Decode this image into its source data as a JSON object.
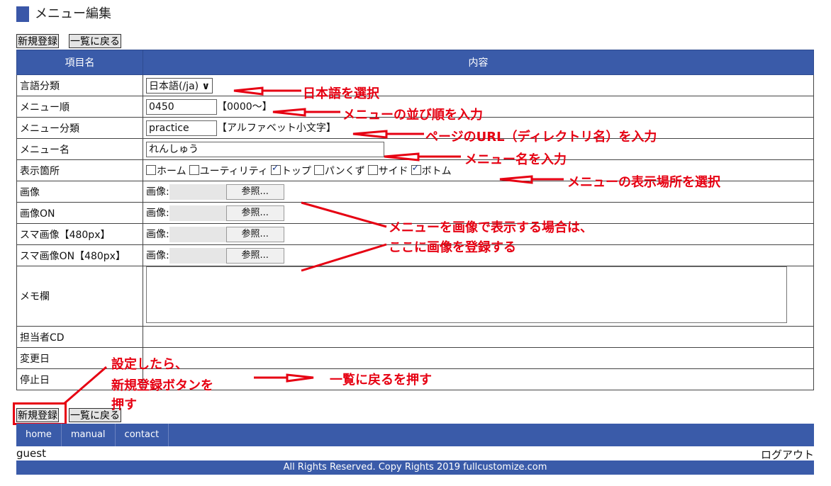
{
  "page": {
    "title": "メニュー編集"
  },
  "top_buttons": {
    "new": "新規登録",
    "list": "一覧に戻る"
  },
  "table": {
    "headers": [
      "項目名",
      "内容"
    ],
    "rows": {
      "language": {
        "label": "言語分類",
        "value": "日本語(/ja)",
        "arrow": "∨"
      },
      "order": {
        "label": "メニュー順",
        "value": "0450",
        "hint": "【0000～】"
      },
      "category": {
        "label": "メニュー分類",
        "value": "practice",
        "hint": "【アルファベット小文字】"
      },
      "name": {
        "label": "メニュー名",
        "value": "れんしゅう"
      },
      "location": {
        "label": "表示箇所",
        "options": [
          {
            "label": "ホーム",
            "checked": false
          },
          {
            "label": "ユーティリティ",
            "checked": false
          },
          {
            "label": "トップ",
            "checked": true
          },
          {
            "label": "パンくず",
            "checked": false
          },
          {
            "label": "サイド",
            "checked": false
          },
          {
            "label": "ボトム",
            "checked": true
          }
        ]
      },
      "image": {
        "label": "画像"
      },
      "image_on": {
        "label": "画像ON"
      },
      "sp_image": {
        "label": "スマ画像【480px】"
      },
      "sp_image_on": {
        "label": "スマ画像ON【480px】"
      },
      "memo": {
        "label": "メモ欄"
      },
      "owner": {
        "label": "担当者CD"
      },
      "updated": {
        "label": "変更日"
      },
      "stopped": {
        "label": "停止日"
      }
    },
    "file_label": "画像:",
    "browse_label": "参照..."
  },
  "bottom_buttons": {
    "new": "新規登録",
    "list": "一覧に戻る"
  },
  "nav": {
    "items": [
      "home",
      "manual",
      "contact"
    ]
  },
  "user": {
    "name": "guest",
    "logout": "ログアウト"
  },
  "footer": {
    "text": "All Rights Reserved. Copy Rights 2019 fullcustomize.com"
  },
  "annotations": {
    "lang": "日本語を選択",
    "order": "メニューの並び順を入力",
    "url": "ページのURL（ディレクトリ名）を入力",
    "name": "メニュー名を入力",
    "location": "メニューの表示場所を選択",
    "image_1": "メニューを画像で表示する場合は、",
    "image_2": "ここに画像を登録する",
    "setup_1": "設定したら、",
    "setup_2": "新規登録ボタンを",
    "setup_3": "押す",
    "back": "一覧に戻るを押す"
  },
  "colors": {
    "header": "#3a5ba9",
    "annotation": "#e60012"
  }
}
